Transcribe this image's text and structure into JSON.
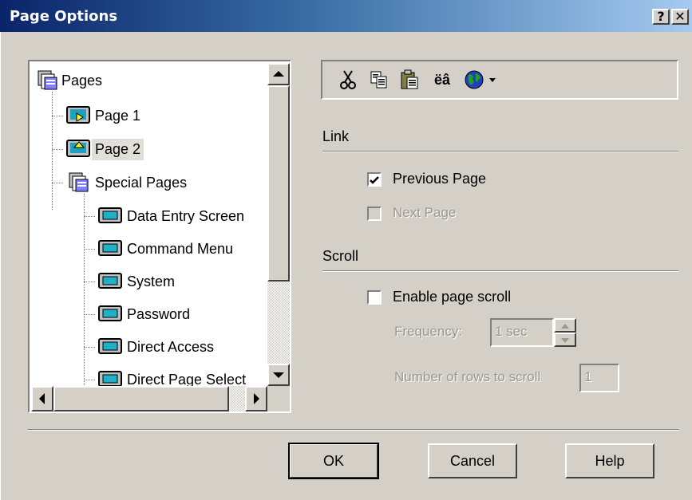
{
  "window": {
    "title": "Page Options",
    "help_label": "?",
    "close_label": "✕"
  },
  "tree": {
    "root": {
      "label": "Pages",
      "icon": "pages-folder-icon"
    },
    "items": [
      {
        "label": "Page 1",
        "icon": "page-icon"
      },
      {
        "label": "Page 2",
        "icon": "page-icon",
        "selected": true
      },
      {
        "label": "Special Pages",
        "icon": "pages-folder-icon"
      },
      {
        "label": "Data Entry Screen",
        "icon": "screen-icon"
      },
      {
        "label": "Command Menu",
        "icon": "screen-icon"
      },
      {
        "label": "System",
        "icon": "screen-icon"
      },
      {
        "label": "Password",
        "icon": "screen-icon"
      },
      {
        "label": "Direct Access",
        "icon": "screen-icon"
      },
      {
        "label": "Direct Page Select",
        "icon": "screen-icon"
      }
    ]
  },
  "toolbar": {
    "special_chars": "ëâ",
    "icons": [
      "cut-icon",
      "copy-icon",
      "paste-icon",
      "special-chars-icon",
      "globe-icon",
      "dropdown-arrow-icon"
    ]
  },
  "link": {
    "heading": "Link",
    "previous_page": {
      "label": "Previous Page",
      "checked": true,
      "enabled": true
    },
    "next_page": {
      "label": "Next Page",
      "checked": false,
      "enabled": false
    }
  },
  "scroll": {
    "heading": "Scroll",
    "enable": {
      "label": "Enable page scroll",
      "checked": false
    },
    "frequency_label": "Frequency:",
    "frequency_value": "1 sec",
    "rows_label": "Number of rows to scroll",
    "rows_value": "1"
  },
  "buttons": {
    "ok": "OK",
    "cancel": "Cancel",
    "help": "Help"
  },
  "colors": {
    "title_start": "#0a246a",
    "title_end": "#a6caf0",
    "face": "#d4d0c8"
  }
}
